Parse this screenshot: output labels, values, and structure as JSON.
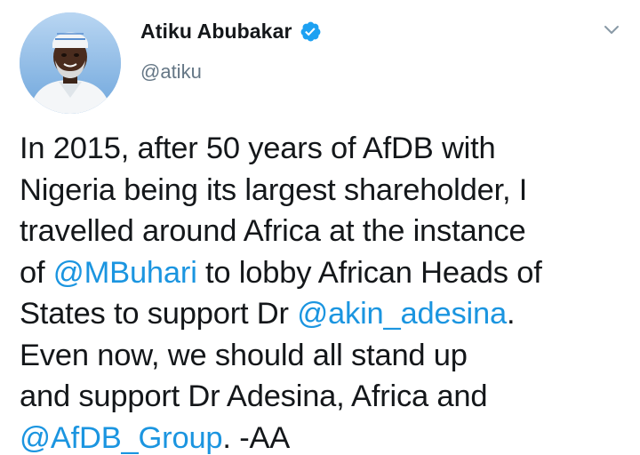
{
  "author": {
    "display_name": "Atiku Abubakar",
    "handle": "@atiku",
    "verified": true,
    "avatar_icon": "profile-photo"
  },
  "menu": {
    "icon": "chevron-down-icon"
  },
  "tweet": {
    "lines": [
      [
        {
          "text": "In 2015, after 50 years of AfDB with",
          "mention": false
        }
      ],
      [
        {
          "text": "Nigeria being its largest shareholder, I",
          "mention": false
        }
      ],
      [
        {
          "text": "travelled around Africa at the instance",
          "mention": false
        }
      ],
      [
        {
          "text": "of ",
          "mention": false
        },
        {
          "text": "@MBuhari",
          "mention": true
        },
        {
          "text": " to lobby African Heads of",
          "mention": false
        }
      ],
      [
        {
          "text": "States to support Dr ",
          "mention": false
        },
        {
          "text": "@akin_adesina",
          "mention": true
        },
        {
          "text": ".",
          "mention": false
        }
      ],
      [
        {
          "text": "Even now, we should all stand up",
          "mention": false
        }
      ],
      [
        {
          "text": "and support Dr Adesina, Africa and",
          "mention": false
        }
      ],
      [
        {
          "text": "@AfDB_Group",
          "mention": true
        },
        {
          "text": ". -AA",
          "mention": false
        }
      ]
    ]
  },
  "colors": {
    "link": "#1b95e0",
    "verified_badge": "#1da1f2",
    "secondary_text": "#657786",
    "primary_text": "#14171a"
  }
}
